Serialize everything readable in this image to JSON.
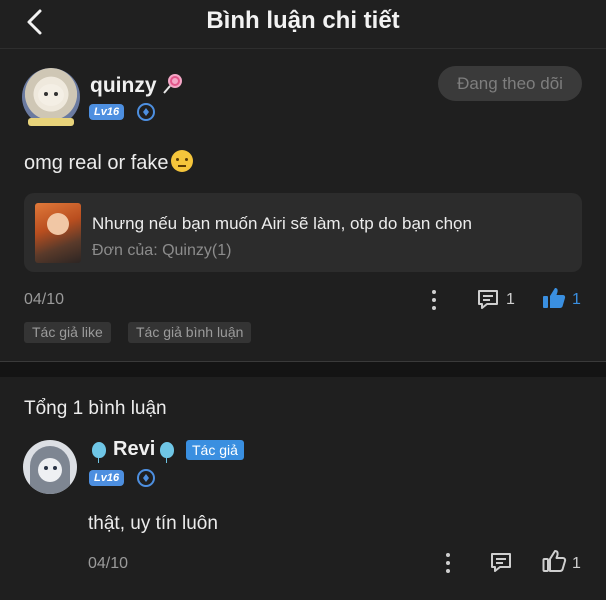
{
  "header": {
    "title": "Bình luận chi tiết"
  },
  "comment": {
    "username": "quinzy",
    "level": "Lv16",
    "follow_button": "Đang theo dõi",
    "text": "omg real or fake",
    "quote": {
      "title": "Nhưng nếu bạn muốn Airi sẽ làm, otp do bạn chọn",
      "subtitle": "Đơn của: Quinzy(1)"
    },
    "date": "04/10",
    "reply_count": "1",
    "like_count": "1",
    "tags": [
      "Tác giả like",
      "Tác giả bình luận"
    ]
  },
  "replies_section": {
    "total_label": "Tổng 1 bình luận",
    "reply": {
      "username": "Revi",
      "author_badge": "Tác giả",
      "level": "Lv16",
      "text": "thật, uy tín luôn",
      "date": "04/10",
      "like_count": "1"
    }
  },
  "colors": {
    "accent": "#3a8fe0",
    "background": "#1f1f1f"
  }
}
